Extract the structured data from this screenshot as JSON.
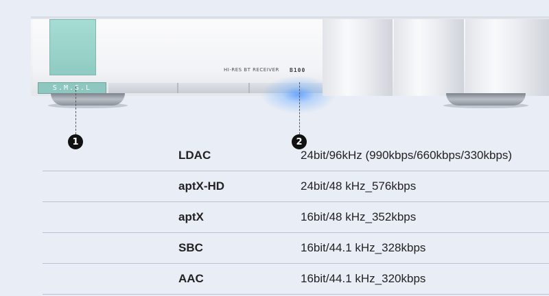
{
  "device": {
    "logo": "S.M.S.L",
    "model_text": "HI-RES BT RECEIVER",
    "model_badge": "B100"
  },
  "markers": [
    "1",
    "2"
  ],
  "specs": [
    {
      "codec": "LDAC",
      "rate": "24bit/96kHz (990kbps/660kbps/330kbps)"
    },
    {
      "codec": "aptX-HD",
      "rate": "24bit/48 kHz_576kbps"
    },
    {
      "codec": "aptX",
      "rate": "16bit/48 kHz_352kbps"
    },
    {
      "codec": "SBC",
      "rate": "16bit/44.1 kHz_328kbps"
    },
    {
      "codec": "AAC",
      "rate": "16bit/44.1 kHz_320kbps"
    }
  ],
  "colors": {
    "background": "#e9edf5",
    "teal_button": "#9ed6cd",
    "indicator_glow": "#569aff",
    "row_divider": "#b9c2d4"
  }
}
